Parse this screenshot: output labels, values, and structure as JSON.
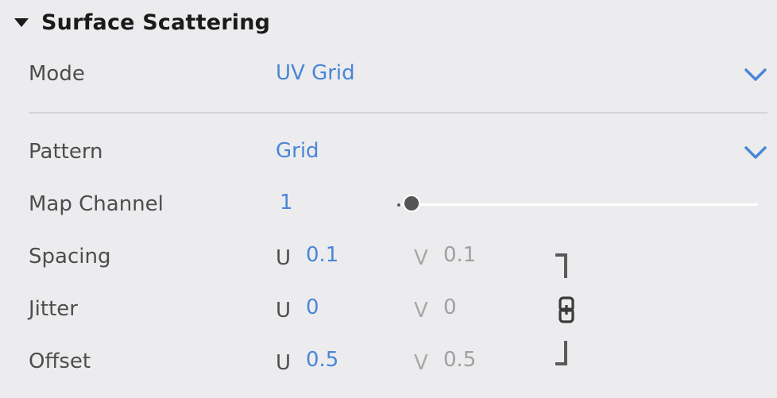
{
  "section": {
    "title": "Surface Scattering"
  },
  "mode": {
    "label": "Mode",
    "value": "UV Grid"
  },
  "pattern": {
    "label": "Pattern",
    "value": "Grid"
  },
  "map_channel": {
    "label": "Map Channel",
    "value": "1"
  },
  "spacing": {
    "label": "Spacing",
    "u_label": "U",
    "u_value": "0.1",
    "v_label": "V",
    "v_value": "0.1"
  },
  "jitter": {
    "label": "Jitter",
    "u_label": "U",
    "u_value": "0",
    "v_label": "V",
    "v_value": "0"
  },
  "offset": {
    "label": "Offset",
    "u_label": "U",
    "u_value": "0.5",
    "v_label": "V",
    "v_value": "0.5"
  },
  "colors": {
    "background": "#ececee",
    "accent": "#4a86d8",
    "label": "#4d4d4d",
    "muted": "#a0a0a0"
  },
  "icons": {
    "collapse": "triangle-down-icon",
    "dropdown": "chevron-down-icon",
    "link": "chain-link-icon"
  }
}
